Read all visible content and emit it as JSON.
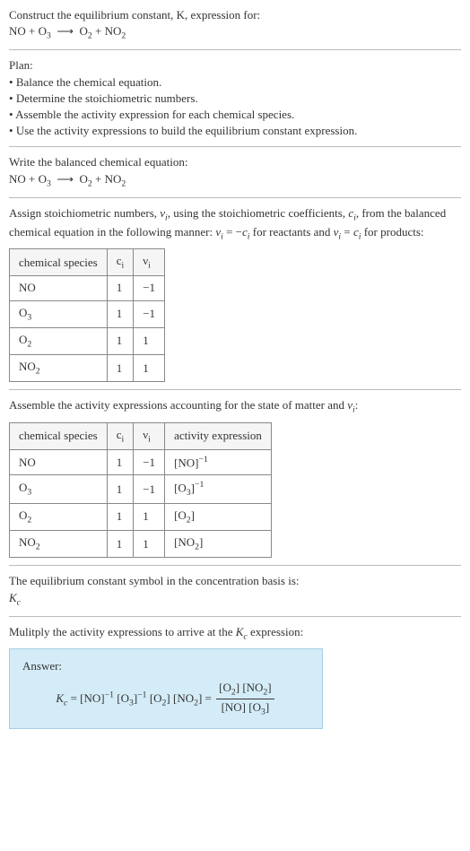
{
  "intro": {
    "prompt": "Construct the equilibrium constant, K, expression for:",
    "equation_html": "NO + O<sub>3</sub> &nbsp;⟶&nbsp; O<sub>2</sub> + NO<sub>2</sub>"
  },
  "plan": {
    "heading": "Plan:",
    "items": [
      "Balance the chemical equation.",
      "Determine the stoichiometric numbers.",
      "Assemble the activity expression for each chemical species.",
      "Use the activity expressions to build the equilibrium constant expression."
    ]
  },
  "balanced": {
    "heading": "Write the balanced chemical equation:",
    "equation_html": "NO + O<sub>3</sub> &nbsp;⟶&nbsp; O<sub>2</sub> + NO<sub>2</sub>"
  },
  "stoich": {
    "heading_html": "Assign stoichiometric numbers, <i>ν<sub>i</sub></i>, using the stoichiometric coefficients, <i>c<sub>i</sub></i>, from the balanced chemical equation in the following manner: <i>ν<sub>i</sub></i> = −<i>c<sub>i</sub></i> for reactants and <i>ν<sub>i</sub></i> = <i>c<sub>i</sub></i> for products:",
    "headers": {
      "species": "chemical species",
      "ci": "c<sub>i</sub>",
      "vi": "ν<sub>i</sub>"
    },
    "rows": [
      {
        "species": "NO",
        "ci": "1",
        "vi": "−1"
      },
      {
        "species": "O<sub>3</sub>",
        "ci": "1",
        "vi": "−1"
      },
      {
        "species": "O<sub>2</sub>",
        "ci": "1",
        "vi": "1"
      },
      {
        "species": "NO<sub>2</sub>",
        "ci": "1",
        "vi": "1"
      }
    ]
  },
  "activity": {
    "heading_html": "Assemble the activity expressions accounting for the state of matter and <i>ν<sub>i</sub></i>:",
    "headers": {
      "species": "chemical species",
      "ci": "c<sub>i</sub>",
      "vi": "ν<sub>i</sub>",
      "expr": "activity expression"
    },
    "rows": [
      {
        "species": "NO",
        "ci": "1",
        "vi": "−1",
        "expr": "[NO]<sup>−1</sup>"
      },
      {
        "species": "O<sub>3</sub>",
        "ci": "1",
        "vi": "−1",
        "expr": "[O<sub>3</sub>]<sup>−1</sup>"
      },
      {
        "species": "O<sub>2</sub>",
        "ci": "1",
        "vi": "1",
        "expr": "[O<sub>2</sub>]"
      },
      {
        "species": "NO<sub>2</sub>",
        "ci": "1",
        "vi": "1",
        "expr": "[NO<sub>2</sub>]"
      }
    ]
  },
  "symbol": {
    "heading": "The equilibrium constant symbol in the concentration basis is:",
    "value_html": "<i>K<sub>c</sub></i>"
  },
  "multiply": {
    "heading_html": "Mulitply the activity expressions to arrive at the <i>K<sub>c</sub></i> expression:"
  },
  "answer": {
    "label": "Answer:",
    "lhs_html": "<i>K<sub>c</sub></i> = [NO]<sup>−1</sup> [O<sub>3</sub>]<sup>−1</sup> [O<sub>2</sub>] [NO<sub>2</sub>] =",
    "frac_num_html": "[O<sub>2</sub>] [NO<sub>2</sub>]",
    "frac_den_html": "[NO] [O<sub>3</sub>]"
  },
  "chart_data": {
    "type": "table",
    "tables": [
      {
        "title": "Stoichiometric numbers",
        "columns": [
          "chemical species",
          "c_i",
          "ν_i"
        ],
        "rows": [
          [
            "NO",
            1,
            -1
          ],
          [
            "O3",
            1,
            -1
          ],
          [
            "O2",
            1,
            1
          ],
          [
            "NO2",
            1,
            1
          ]
        ]
      },
      {
        "title": "Activity expressions",
        "columns": [
          "chemical species",
          "c_i",
          "ν_i",
          "activity expression"
        ],
        "rows": [
          [
            "NO",
            1,
            -1,
            "[NO]^-1"
          ],
          [
            "O3",
            1,
            -1,
            "[O3]^-1"
          ],
          [
            "O2",
            1,
            1,
            "[O2]"
          ],
          [
            "NO2",
            1,
            1,
            "[NO2]"
          ]
        ]
      }
    ]
  }
}
